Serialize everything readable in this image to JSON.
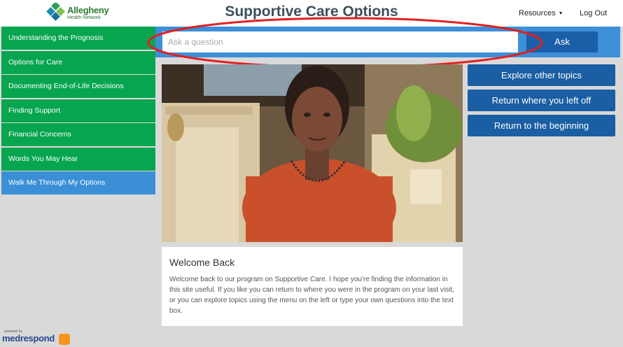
{
  "header": {
    "logo_line1": "Allegheny",
    "logo_line2": "Health Network",
    "title": "Supportive Care Options",
    "resources_label": "Resources",
    "logout_label": "Log Out"
  },
  "sidebar": {
    "items": [
      {
        "label": "Understanding the Prognosis"
      },
      {
        "label": "Options for Care"
      },
      {
        "label": "Documenting End-of-Life Decisions"
      },
      {
        "label": "Finding Support"
      },
      {
        "label": "Financial Concerns"
      },
      {
        "label": "Words You May Hear"
      },
      {
        "label": "Walk Me Through My Options"
      }
    ]
  },
  "search": {
    "placeholder": "Ask a question",
    "value": "",
    "ask_label": "Ask"
  },
  "side_buttons": {
    "explore": "Explore other topics",
    "return_left": "Return where you left off",
    "return_begin": "Return to the beginning"
  },
  "welcome": {
    "title": "Welcome Back",
    "body": "Welcome back to our program on Supportive Care. I hope you're finding the information in this site useful. If you like you can return to where you were in the program on your last visit, or you can explore topics using the menu on the left or type your own questions into the text box."
  },
  "footer": {
    "powered_by": "powered by",
    "brand": "medrespond"
  },
  "colors": {
    "green_nav": "#07a54f",
    "active_nav": "#3a8fd6",
    "search_bar": "#3d8fd8",
    "dark_blue_button": "#1a5ea3",
    "annotation_red": "#e02020"
  },
  "icons": {
    "logo": "allegheny-logo-icon",
    "caret": "caret-down-icon",
    "video": "video-presenter-image"
  }
}
